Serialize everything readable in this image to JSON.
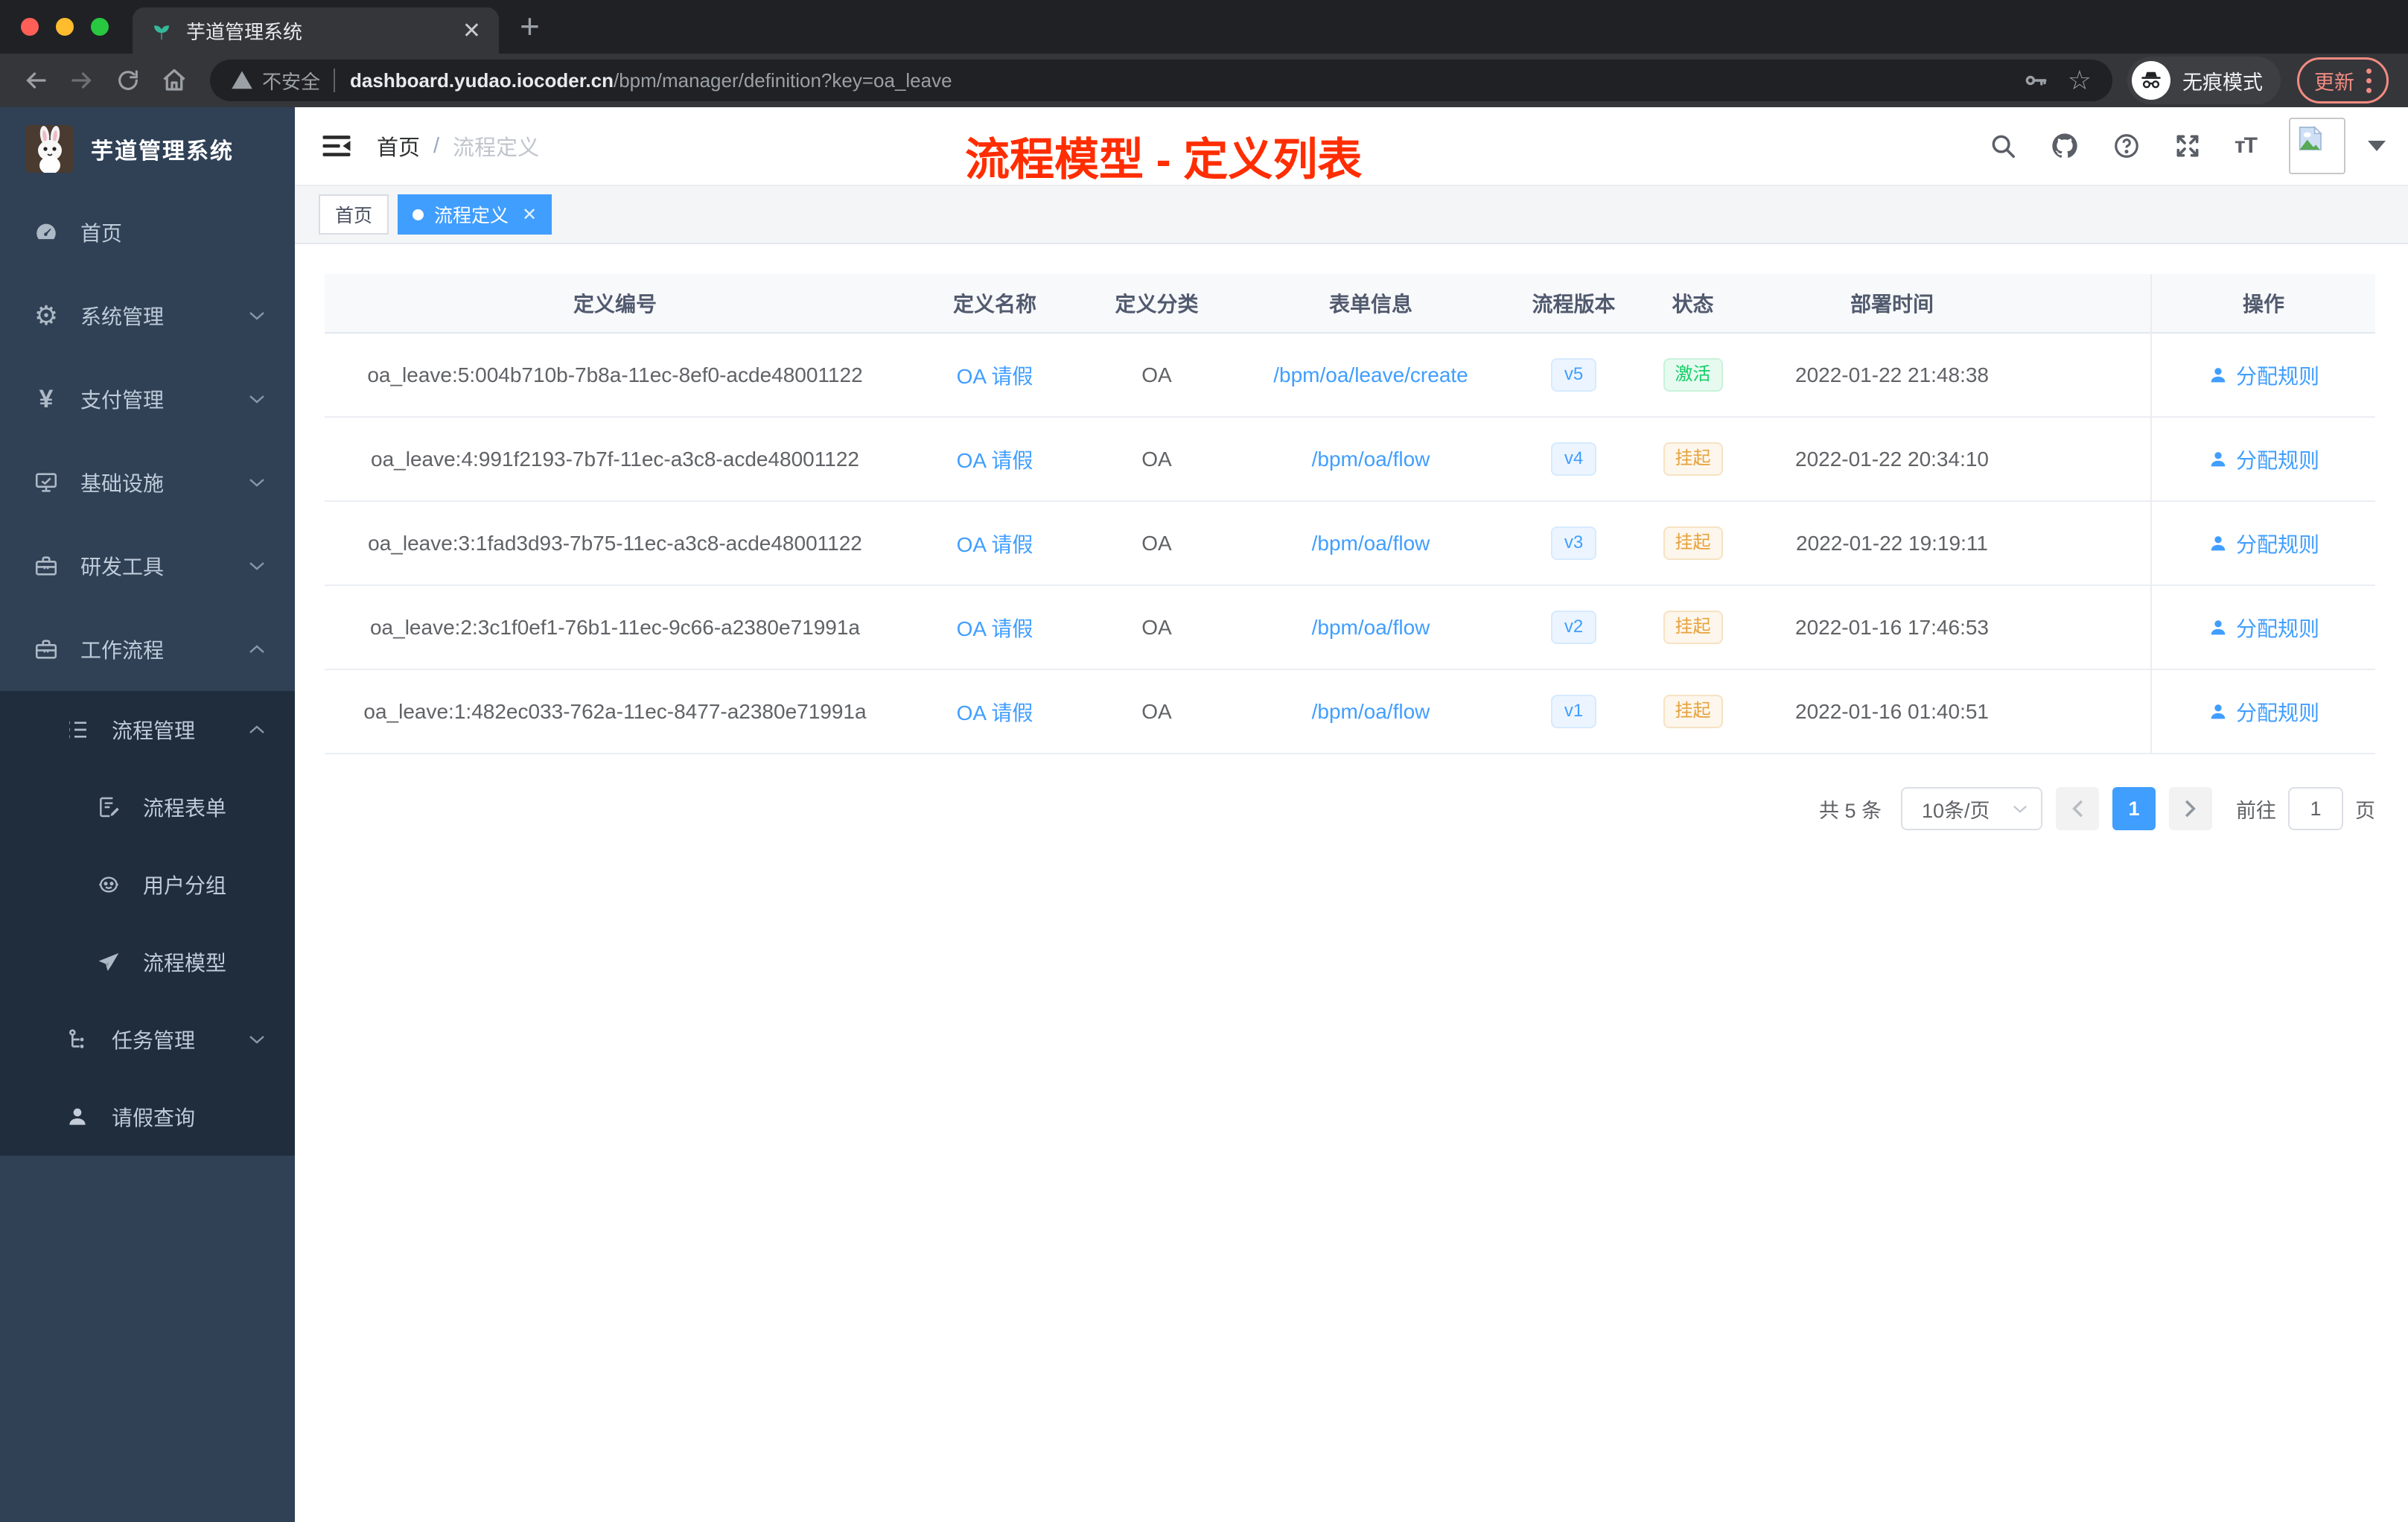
{
  "browser": {
    "tab_title": "芋道管理系统",
    "security_label": "不安全",
    "url_domain": "dashboard.yudao.iocoder.cn",
    "url_path": "/bpm/manager/definition?key=oa_leave",
    "incognito_label": "无痕模式",
    "update_label": "更新"
  },
  "sidebar": {
    "title": "芋道管理系统",
    "menu": {
      "home": "首页",
      "system": "系统管理",
      "payment": "支付管理",
      "infra": "基础设施",
      "dev_tools": "研发工具",
      "workflow": "工作流程",
      "process_mgmt": "流程管理",
      "process_form": "流程表单",
      "user_group": "用户分组",
      "process_model": "流程模型",
      "task_mgmt": "任务管理",
      "leave_query": "请假查询"
    }
  },
  "header": {
    "breadcrumb_home": "首页",
    "breadcrumb_current": "流程定义",
    "annotation": "流程模型 - 定义列表"
  },
  "tags": {
    "home": "首页",
    "active": "流程定义"
  },
  "table": {
    "columns": [
      "定义编号",
      "定义名称",
      "定义分类",
      "表单信息",
      "流程版本",
      "状态",
      "部署时间",
      "操作"
    ],
    "rows": [
      {
        "id": "oa_leave:5:004b710b-7b8a-11ec-8ef0-acde48001122",
        "name": "OA 请假",
        "category": "OA",
        "form": "/bpm/oa/leave/create",
        "version": "v5",
        "status": "激活",
        "status_type": "success",
        "deploy_time": "2022-01-22 21:48:38",
        "action": "分配规则"
      },
      {
        "id": "oa_leave:4:991f2193-7b7f-11ec-a3c8-acde48001122",
        "name": "OA 请假",
        "category": "OA",
        "form": "/bpm/oa/flow",
        "version": "v4",
        "status": "挂起",
        "status_type": "warning",
        "deploy_time": "2022-01-22 20:34:10",
        "action": "分配规则"
      },
      {
        "id": "oa_leave:3:1fad3d93-7b75-11ec-a3c8-acde48001122",
        "name": "OA 请假",
        "category": "OA",
        "form": "/bpm/oa/flow",
        "version": "v3",
        "status": "挂起",
        "status_type": "warning",
        "deploy_time": "2022-01-22 19:19:11",
        "action": "分配规则"
      },
      {
        "id": "oa_leave:2:3c1f0ef1-76b1-11ec-9c66-a2380e71991a",
        "name": "OA 请假",
        "category": "OA",
        "form": "/bpm/oa/flow",
        "version": "v2",
        "status": "挂起",
        "status_type": "warning",
        "deploy_time": "2022-01-16 17:46:53",
        "action": "分配规则"
      },
      {
        "id": "oa_leave:1:482ec033-762a-11ec-8477-a2380e71991a",
        "name": "OA 请假",
        "category": "OA",
        "form": "/bpm/oa/flow",
        "version": "v1",
        "status": "挂起",
        "status_type": "warning",
        "deploy_time": "2022-01-16 01:40:51",
        "action": "分配规则"
      }
    ]
  },
  "pagination": {
    "total": "共 5 条",
    "page_size": "10条/页",
    "current_page": "1",
    "goto_label": "前往",
    "goto_value": "1",
    "page_label": "页"
  },
  "colors": {
    "accent_blue": "#409eff",
    "success_green": "#13ce66",
    "warning_orange": "#e6a23c",
    "sidebar_bg": "#304156",
    "submenu_bg": "#1f2d3d",
    "annotation_red": "#ff2d00",
    "update_red": "#f28b82"
  }
}
